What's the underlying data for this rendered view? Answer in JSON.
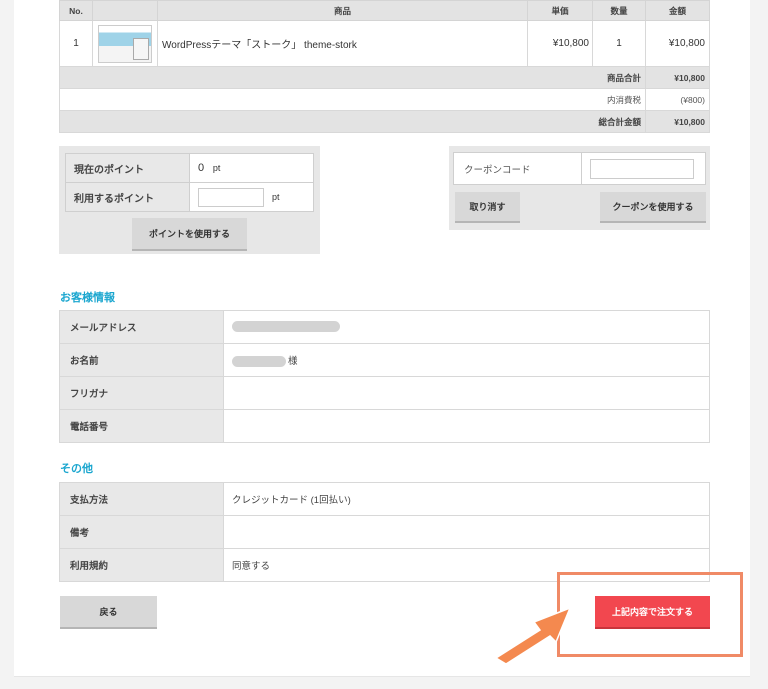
{
  "order_table": {
    "headers": [
      "No.",
      "",
      "商品",
      "単価",
      "数量",
      "金額"
    ],
    "rows": [
      {
        "no": "1",
        "product": "WordPressテーマ「ストーク」 theme-stork",
        "unit_price": "¥10,800",
        "qty": "1",
        "amount": "¥10,800"
      }
    ],
    "summary": [
      {
        "label": "商品合計",
        "value": "¥10,800"
      },
      {
        "label": "内消費税",
        "value": "(¥800)"
      },
      {
        "label": "総合計金額",
        "value": "¥10,800"
      }
    ]
  },
  "points": {
    "current_label": "現在のポイント",
    "current_value": "0",
    "current_unit": "pt",
    "use_label": "利用するポイント",
    "use_unit": "pt",
    "use_button": "ポイントを使用する"
  },
  "coupon": {
    "label": "クーポンコード",
    "cancel_button": "取り消す",
    "use_button": "クーポンを使用する"
  },
  "customer": {
    "heading": "お客様情報",
    "rows": [
      {
        "label": "メールアドレス",
        "value": ""
      },
      {
        "label": "お名前",
        "value": "様"
      },
      {
        "label": "フリガナ",
        "value": ""
      },
      {
        "label": "電話番号",
        "value": ""
      }
    ]
  },
  "other": {
    "heading": "その他",
    "rows": [
      {
        "label": "支払方法",
        "value": "クレジットカード (1回払い)"
      },
      {
        "label": "備考",
        "value": ""
      },
      {
        "label": "利用規約",
        "value": "同意する"
      }
    ]
  },
  "actions": {
    "back_button": "戻る",
    "submit_button": "上記内容で注文する"
  },
  "colors": {
    "accent": "#1aa6cf",
    "submit": "#f2474f",
    "highlight": "#f08a66"
  }
}
